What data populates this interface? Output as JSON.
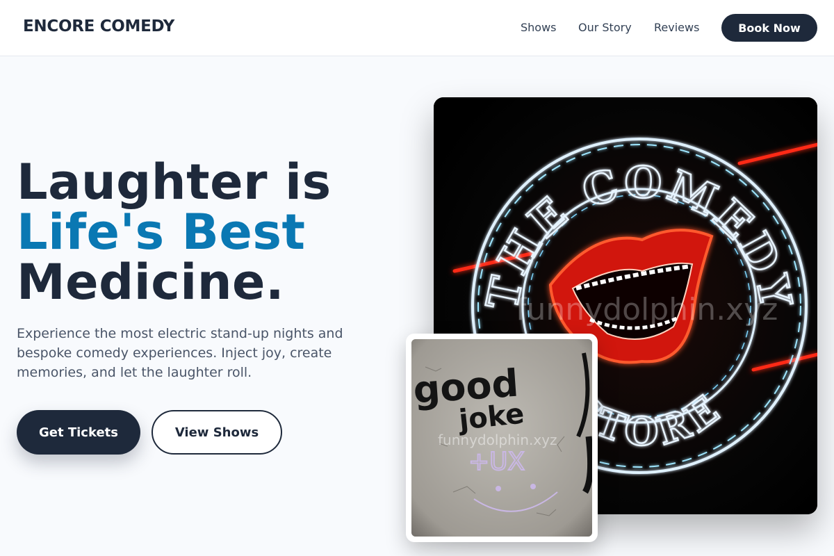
{
  "header": {
    "logo": "ENCORE COMEDY",
    "nav": [
      "Shows",
      "Our Story",
      "Reviews"
    ],
    "cta": "Book Now"
  },
  "hero": {
    "headline_line1": "Laughter is",
    "headline_accent": "Life's Best",
    "headline_line3": "Medicine.",
    "subtext": "Experience the most electric stand-up nights and bespoke comedy experiences. Inject joy, create memories, and let the laughter roll.",
    "primary_button": "Get Tickets",
    "secondary_button": "View Shows"
  },
  "images": {
    "main": {
      "icon": "neon-comedy-store-sign",
      "sign_text_top": "THE COMEDY",
      "sign_text_bottom": "STORE",
      "watermark": "funnydolphin.xyz"
    },
    "inset": {
      "icon": "graffiti-wall",
      "graffiti_line1": "good",
      "graffiti_line2": "joke",
      "graffiti_line3": "+UX",
      "watermark": "funnydolphin.xyz"
    }
  },
  "colors": {
    "navy": "#1e293b",
    "accent_blue": "#0a78b3",
    "background": "#f8fafd",
    "neon_red": "#ff2a14",
    "neon_white": "#e8f4ff"
  }
}
